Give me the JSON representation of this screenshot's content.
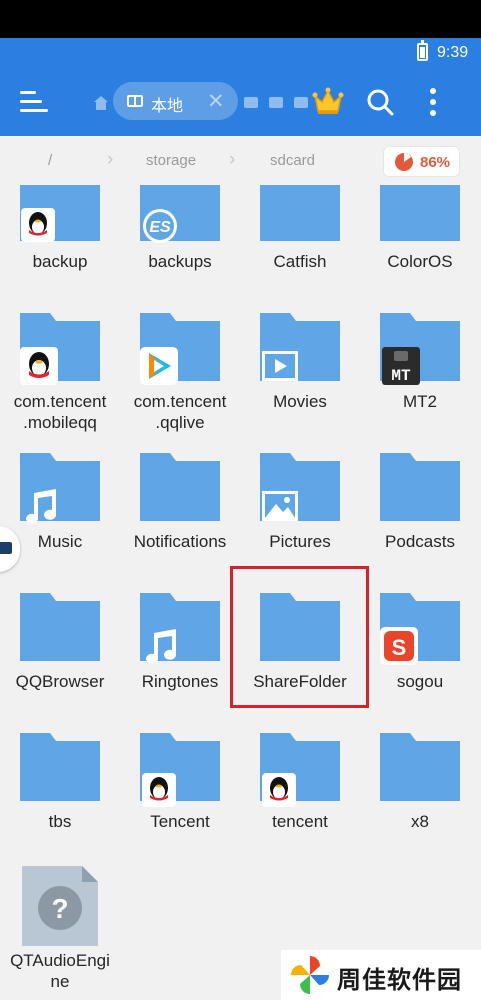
{
  "status_bar": {
    "time": "9:39"
  },
  "toolbar": {
    "tab_label": "本地",
    "tab_close": "✕"
  },
  "breadcrumb": {
    "root": "/",
    "items": [
      "storage",
      "sdcard"
    ],
    "separator": "›",
    "storage_usage": "86%"
  },
  "files": [
    {
      "name": "backup",
      "type": "folder"
    },
    {
      "name": "backups",
      "type": "folder"
    },
    {
      "name": "Catfish",
      "type": "folder"
    },
    {
      "name": "ColorOS",
      "type": "folder"
    },
    {
      "name": "com.tencent .mobileqq",
      "line1": "com.tencent",
      "line2": ".mobileqq",
      "type": "folder"
    },
    {
      "name": "com.tencent .qqlive",
      "line1": "com.tencent",
      "line2": ".qqlive",
      "type": "folder"
    },
    {
      "name": "Movies",
      "type": "folder"
    },
    {
      "name": "MT2",
      "type": "folder"
    },
    {
      "name": "Music",
      "type": "folder"
    },
    {
      "name": "Notifications",
      "type": "folder"
    },
    {
      "name": "Pictures",
      "type": "folder"
    },
    {
      "name": "Podcasts",
      "type": "folder"
    },
    {
      "name": "QQBrowser",
      "type": "folder"
    },
    {
      "name": "Ringtones",
      "type": "folder"
    },
    {
      "name": "ShareFolder",
      "type": "folder",
      "highlighted": true
    },
    {
      "name": "sogou",
      "type": "folder"
    },
    {
      "name": "tbs",
      "type": "folder"
    },
    {
      "name": "Tencent",
      "type": "folder"
    },
    {
      "name": "tencent",
      "type": "folder"
    },
    {
      "name": "x8",
      "type": "folder"
    },
    {
      "name": "QTAudioEngine",
      "line1": "QTAudioEngi",
      "line2": "ne",
      "type": "unknown-file"
    }
  ],
  "badges": {
    "es": "ES",
    "mt": "MT",
    "sogou": "S",
    "unknown": "?"
  },
  "watermark": {
    "text": "周佳软件园"
  },
  "colors": {
    "toolbar": "#2b7fe0",
    "folder": "#5fa6e6",
    "highlight": "#d6232b",
    "storage_usage": "#e15a3b"
  }
}
